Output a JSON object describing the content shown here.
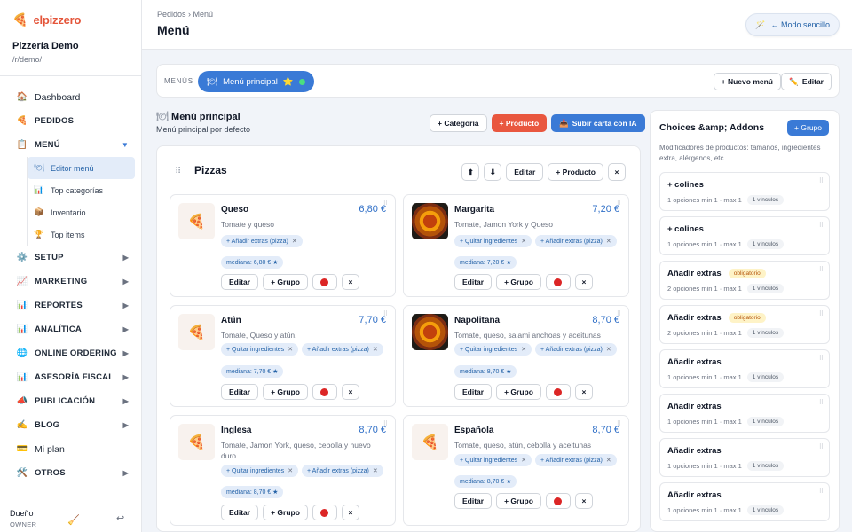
{
  "brand": {
    "logo_icon": "pizza-slice-icon",
    "name": "elpizzero"
  },
  "org": {
    "name": "Pizzería Demo",
    "path": "/r/demo/"
  },
  "nav": {
    "items": [
      {
        "label": "Dashboard",
        "icon": "home-icon",
        "plain": true
      },
      {
        "label": "PEDIDOS",
        "icon": "pizza-icon"
      },
      {
        "label": "MENÚ",
        "icon": "clipboard-icon",
        "expanded": true
      }
    ],
    "sub_items": [
      {
        "label": "Editor menú",
        "icon": "fork-knife-icon",
        "active": true
      },
      {
        "label": "Top categorías",
        "icon": "bar-chart-icon"
      },
      {
        "label": "Inventario",
        "icon": "box-icon"
      },
      {
        "label": "Top items",
        "icon": "trophy-icon"
      }
    ],
    "more_items": [
      {
        "label": "SETUP",
        "icon": "gear-icon"
      },
      {
        "label": "MARKETING",
        "icon": "trend-chart-icon"
      },
      {
        "label": "REPORTES",
        "icon": "bar-chart-icon"
      },
      {
        "label": "ANALÍTICA",
        "icon": "bar-chart-icon"
      },
      {
        "label": "ONLINE ORDERING",
        "icon": "globe-icon"
      },
      {
        "label": "ASESORÍA FISCAL",
        "icon": "bar-chart-icon"
      },
      {
        "label": "PUBLICACIÓN",
        "icon": "megaphone-icon"
      },
      {
        "label": "BLOG",
        "icon": "pen-icon"
      },
      {
        "label": "Mi plan",
        "icon": "card-icon",
        "plain": true
      },
      {
        "label": "OTROS",
        "icon": "tools-icon"
      }
    ]
  },
  "user": {
    "name": "Dueño",
    "role": "OWNER"
  },
  "header": {
    "breadcrumb": "Pedidos › Menú",
    "title": "Menú",
    "simple_mode": "← Modo sencillo"
  },
  "menubar": {
    "label": "MENÚS",
    "active_menu": "Menú principal",
    "star": "⭐",
    "new_menu": "+ Nuevo menú",
    "edit": "Editar"
  },
  "menu_head": {
    "title": "Menú principal",
    "subtitle": "Menú principal por defecto",
    "add_category": "+ Categoría",
    "add_product": "+ Producto",
    "upload_ai": "Subir carta con IA"
  },
  "category": {
    "title": "Pizzas",
    "edit": "Editar",
    "add_product": "+ Producto",
    "products": [
      {
        "name": "Queso",
        "price": "6,80 €",
        "desc": "Tomate y queso",
        "tags": [
          "+ Añadir extras (pizza)"
        ],
        "size": "mediana: 6,80 € ★",
        "photo": false
      },
      {
        "name": "Margarita",
        "price": "7,20 €",
        "desc": "Tomate, Jamon York y Queso",
        "tags": [
          "+ Quitar ingredientes",
          "+ Añadir extras (pizza)"
        ],
        "size": "mediana: 7,20 € ★",
        "photo": true
      },
      {
        "name": "Atún",
        "price": "7,70 €",
        "desc": "Tomate, Queso y atún.",
        "tags": [
          "+ Quitar ingredientes",
          "+ Añadir extras (pizza)"
        ],
        "size": "mediana: 7,70 € ★",
        "photo": false
      },
      {
        "name": "Napolitana",
        "price": "8,70 €",
        "desc": "Tomate, queso, salami anchoas y aceitunas",
        "tags": [
          "+ Quitar ingredientes",
          "+ Añadir extras (pizza)"
        ],
        "size": "mediana: 8,70 € ★",
        "photo": true
      },
      {
        "name": "Inglesa",
        "price": "8,70 €",
        "desc": "Tomate, Jamon York, queso, cebolla y huevo duro",
        "tags": [
          "+ Quitar ingredientes",
          "+ Añadir extras (pizza)"
        ],
        "size": "mediana: 8,70 € ★",
        "photo": false
      },
      {
        "name": "Española",
        "price": "8,70 €",
        "desc": "Tomate, queso, atún, cebolla y aceitunas",
        "tags": [
          "+ Quitar ingredientes",
          "+ Añadir extras (pizza)"
        ],
        "size": "mediana: 8,70 € ★",
        "photo": false
      }
    ],
    "card_edit": "Editar",
    "card_group": "+ Grupo"
  },
  "choices": {
    "title": "Choices &amp; Addons",
    "add_group": "+ Grupo",
    "description": "Modificadores de productos: tamaños, ingredientes extra, alérgenos, etc.",
    "groups": [
      {
        "name": "+ colines",
        "required": "",
        "meta": "1 opciones   min 1 · max 1",
        "links": "1 vínculos"
      },
      {
        "name": "+ colines",
        "required": "",
        "meta": "1 opciones   min 1 · max 1",
        "links": "1 vínculos"
      },
      {
        "name": "Añadir extras",
        "required": "obligatorio",
        "meta": "2 opciones   min 1 · max 1",
        "links": "1 vínculos"
      },
      {
        "name": "Añadir extras",
        "required": "obligatorio",
        "meta": "2 opciones   min 1 · max 1",
        "links": "1 vínculos"
      },
      {
        "name": "Añadir extras",
        "required": "",
        "meta": "1 opciones   min 1 · max 1",
        "links": "1 vínculos"
      },
      {
        "name": "Añadir extras",
        "required": "",
        "meta": "1 opciones   min 1 · max 1",
        "links": "1 vínculos"
      },
      {
        "name": "Añadir extras",
        "required": "",
        "meta": "1 opciones   min 1 · max 1",
        "links": "1 vínculos"
      },
      {
        "name": "Añadir extras",
        "required": "",
        "meta": "1 opciones   min 1 · max 1",
        "links": "1 vínculos"
      }
    ]
  },
  "colors": {
    "accent": "#3a7ad6",
    "brand": "#e4553a",
    "price": "#2f6fc7"
  }
}
